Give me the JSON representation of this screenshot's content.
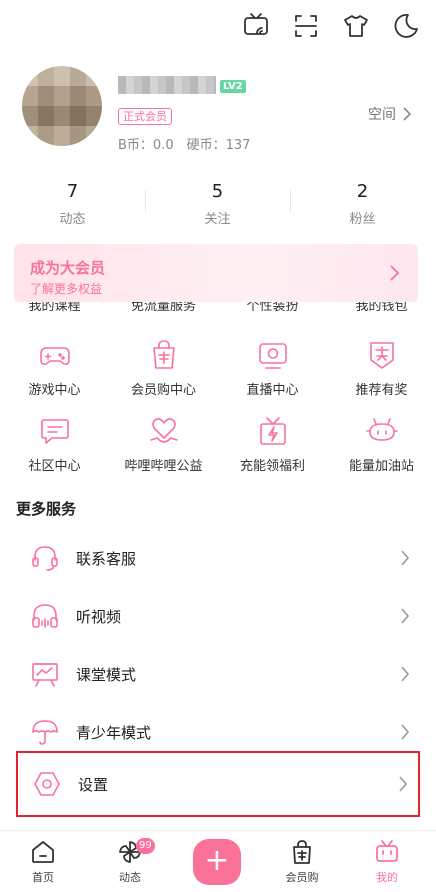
{
  "profile": {
    "level": "LV2",
    "vip_badge": "正式会员",
    "coins": "B币：0.0　硬币：137",
    "space_label": "空间"
  },
  "stats": [
    {
      "value": "7",
      "label": "动态"
    },
    {
      "value": "5",
      "label": "关注"
    },
    {
      "value": "2",
      "label": "粉丝"
    }
  ],
  "banner": {
    "title": "成为大会员",
    "subtitle": "了解更多权益"
  },
  "grid_cut_row": [
    "我的课程",
    "免流量服务",
    "个性装扮",
    "我的钱包"
  ],
  "grid": [
    {
      "label": "游戏中心",
      "icon": "gamepad-icon"
    },
    {
      "label": "会员购中心",
      "icon": "shopping-bag-icon"
    },
    {
      "label": "直播中心",
      "icon": "live-tv-icon"
    },
    {
      "label": "推荐有奖",
      "icon": "award-icon"
    },
    {
      "label": "社区中心",
      "icon": "chat-icon"
    },
    {
      "label": "哔哩哔哩公益",
      "icon": "heart-hand-icon"
    },
    {
      "label": "充能领福利",
      "icon": "gift-bolt-icon"
    },
    {
      "label": "能量加油站",
      "icon": "energy-station-icon"
    }
  ],
  "more_services_title": "更多服务",
  "services": [
    {
      "label": "联系客服",
      "icon": "headset-icon"
    },
    {
      "label": "听视频",
      "icon": "headphones-icon"
    },
    {
      "label": "课堂模式",
      "icon": "classroom-icon"
    },
    {
      "label": "青少年模式",
      "icon": "umbrella-icon"
    },
    {
      "label": "设置",
      "icon": "settings-hexagon-icon"
    }
  ],
  "bottom_nav": {
    "home": "首页",
    "dynamic": "动态",
    "dynamic_badge": "99",
    "plus": "+",
    "shop": "会员购",
    "mine": "我的"
  },
  "colors": {
    "accent": "#fb7299",
    "highlight_box": "#e0232c"
  }
}
